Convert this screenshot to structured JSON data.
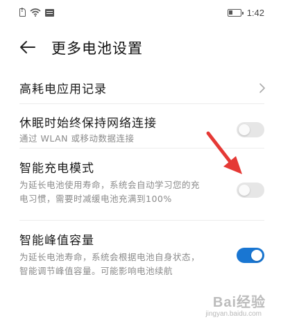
{
  "status_bar": {
    "time": "1:42",
    "icons": [
      "sim-alert-icon",
      "wifi-icon",
      "message-icon",
      "battery-icon"
    ]
  },
  "header": {
    "title": "更多电池设置",
    "back_icon": "arrow-left-icon"
  },
  "settings": [
    {
      "title": "高耗电应用记录",
      "control": "chevron"
    },
    {
      "title": "休眠时始终保持网络连接",
      "subtitle": "通过 WLAN 或移动数据连接",
      "control": "toggle",
      "enabled": false
    },
    {
      "title": "智能充电模式",
      "subtitle": "为延长电池使用寿命，系统会自动学习您的充电习惯，需要时减缓电池充满到100%",
      "control": "toggle",
      "enabled": false
    },
    {
      "title": "智能峰值容量",
      "subtitle": "为延长电池寿命，系统会根据电池自身状态，智能调节峰值容量。可能影响电池续航",
      "control": "toggle",
      "enabled": true
    }
  ],
  "colors": {
    "toggle_on": "#1976d2",
    "toggle_off": "#e6e6e6",
    "annotation_arrow": "#e53935"
  },
  "watermark": {
    "main": "Bai经验",
    "sub": "jingyan.baidu.com"
  }
}
